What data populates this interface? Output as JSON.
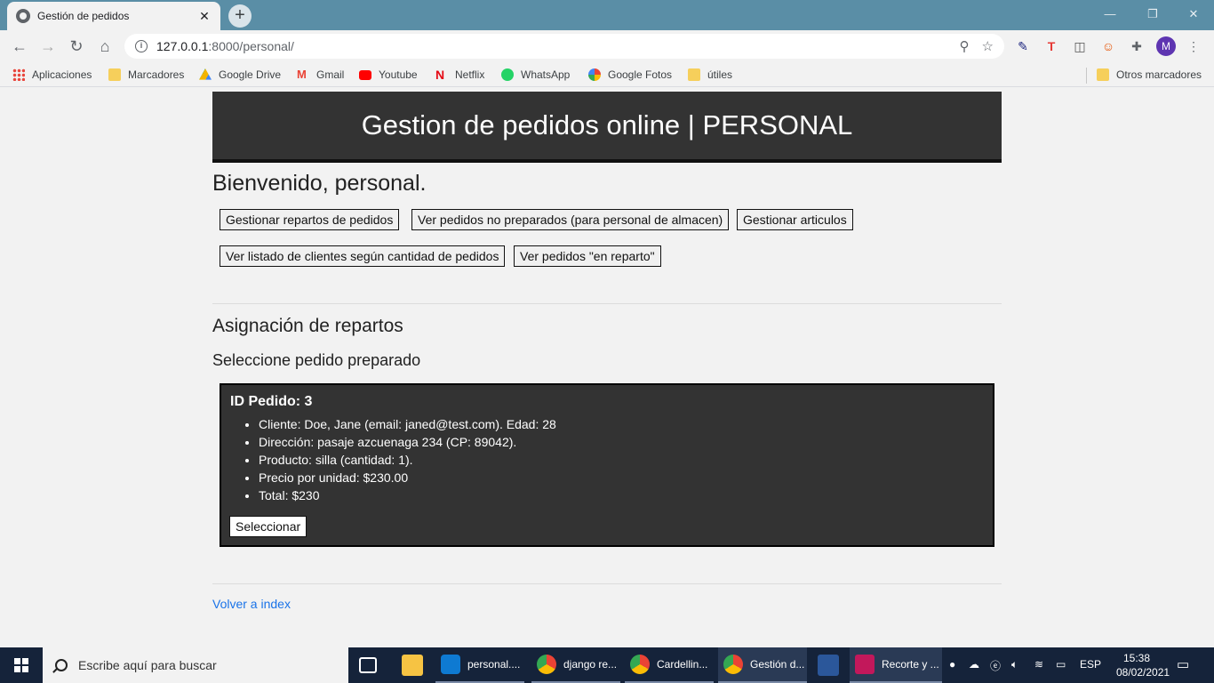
{
  "browser": {
    "tab_title": "Gestión de pedidos",
    "url_host": "127.0.0.1",
    "url_rest": ":8000/personal/",
    "profile_initial": "M"
  },
  "bookmarks": [
    {
      "label": "Aplicaciones",
      "icon": "apps-grid-icon"
    },
    {
      "label": "Marcadores",
      "icon": "folder-icon"
    },
    {
      "label": "Google Drive",
      "icon": "drive-icon"
    },
    {
      "label": "Gmail",
      "icon": "gmail-icon"
    },
    {
      "label": "Youtube",
      "icon": "youtube-icon"
    },
    {
      "label": "Netflix",
      "icon": "netflix-icon"
    },
    {
      "label": "WhatsApp",
      "icon": "whatsapp-icon"
    },
    {
      "label": "Google Fotos",
      "icon": "photos-icon"
    },
    {
      "label": "útiles",
      "icon": "folder-icon"
    }
  ],
  "other_bookmarks": "Otros marcadores",
  "page": {
    "header_title": "Gestion de pedidos online | PERSONAL",
    "welcome": "Bienvenido, personal.",
    "buttons": [
      "Gestionar repartos de pedidos",
      "Ver pedidos no preparados (para personal de almacen)",
      "Gestionar articulos",
      "Ver listado de clientes según cantidad de pedidos",
      "Ver pedidos \"en reparto\""
    ],
    "section_title": "Asignación de repartos",
    "subsection_title": "Seleccione pedido preparado",
    "order": {
      "id_label": "ID Pedido: 3",
      "lines": [
        "Cliente: Doe, Jane (email: janed@test.com). Edad: 28",
        "Dirección: pasaje azcuenaga 234 (CP: 89042).",
        "Producto: silla (cantidad: 1).",
        "Precio por unidad: $230.00",
        "Total: $230"
      ],
      "select_label": "Seleccionar"
    },
    "back_link": "Volver a index"
  },
  "taskbar": {
    "search_placeholder": "Escribe aquí para buscar",
    "apps": [
      {
        "label": "personal....",
        "color": "#0e7ad2"
      },
      {
        "label": "django re...",
        "color": "#e8453c"
      },
      {
        "label": "Cardellin...",
        "color": "#e8453c"
      },
      {
        "label": "Gestión d...",
        "color": "#e8453c"
      },
      {
        "label": "Recorte y ...",
        "color": "#c2185b"
      }
    ],
    "lang": "ESP",
    "time": "15:38",
    "date": "08/02/2021"
  },
  "colors": {
    "header_bg": "#333333",
    "link": "#1a73e8",
    "chrome_frame": "#5a8ea6",
    "taskbar": "#15233a"
  }
}
